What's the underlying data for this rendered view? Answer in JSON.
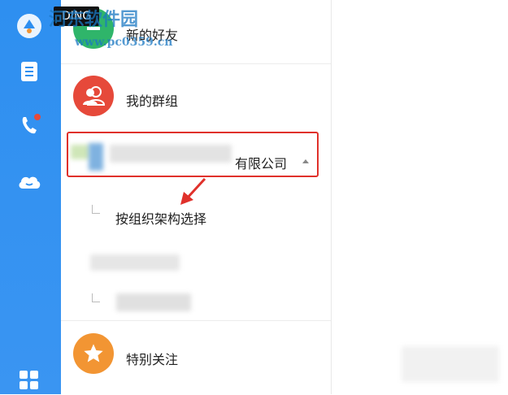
{
  "sidebar": {
    "items": [
      {
        "icon": "app-logo-icon"
      },
      {
        "icon": "notebook-icon"
      },
      {
        "icon": "phone-icon",
        "badge": true
      },
      {
        "icon": "cloud-icon"
      },
      {
        "icon": "apps-grid-icon"
      }
    ],
    "accent": "#2e8ff0"
  },
  "tooltip": {
    "ding": "DING"
  },
  "contacts": {
    "new_friends": "新的好友",
    "my_groups": "我的群组",
    "company_suffix": "有限公司",
    "org_select": "按组织架构选择",
    "special_follow": "特别关注"
  },
  "watermark": {
    "site": "河东软件园",
    "url": "www.pc0359.cn"
  },
  "colors": {
    "new_friends_avatar": "#2fb56a",
    "groups_avatar": "#e6493a",
    "follow_avatar": "#f29533",
    "highlight": "#e0312b"
  }
}
